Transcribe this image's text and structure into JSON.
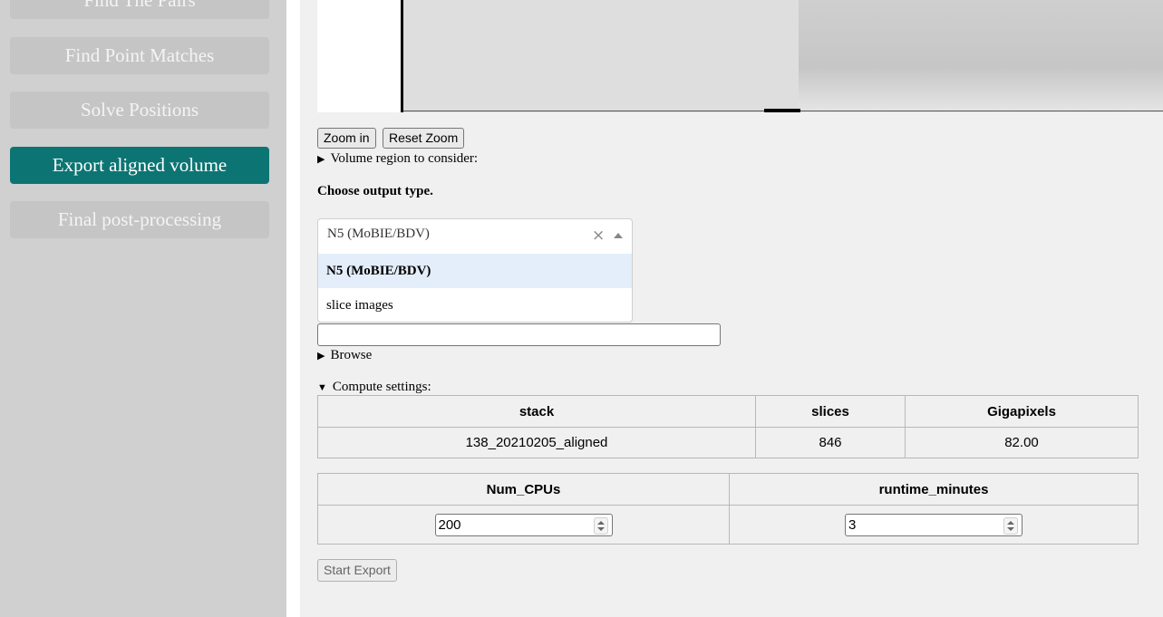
{
  "sidebar": {
    "items": [
      {
        "label": "Find The Pairs"
      },
      {
        "label": "Find Point Matches"
      },
      {
        "label": "Solve Positions"
      },
      {
        "label": "Export aligned volume"
      },
      {
        "label": "Final post-processing"
      }
    ],
    "accent": "#0c7573"
  },
  "viewer": {
    "zoom_in": "Zoom in",
    "reset_zoom": "Reset Zoom"
  },
  "volume_region": "Volume region to consider:",
  "output": {
    "title": "Choose output type.",
    "selected": "N5 (MoBIE/BDV)",
    "options": [
      "N5 (MoBIE/BDV)",
      "slice images"
    ],
    "path_value": ""
  },
  "browse": "Browse",
  "compute_label": "Compute settings:",
  "stack_table": {
    "headers": [
      "stack",
      "slices",
      "Gigapixels"
    ],
    "row": [
      "138_20210205_aligned",
      "846",
      "82.00"
    ]
  },
  "compute_table": {
    "headers": [
      "Num_CPUs",
      "runtime_minutes"
    ],
    "values": [
      "200",
      "3"
    ]
  },
  "start_export": "Start Export"
}
